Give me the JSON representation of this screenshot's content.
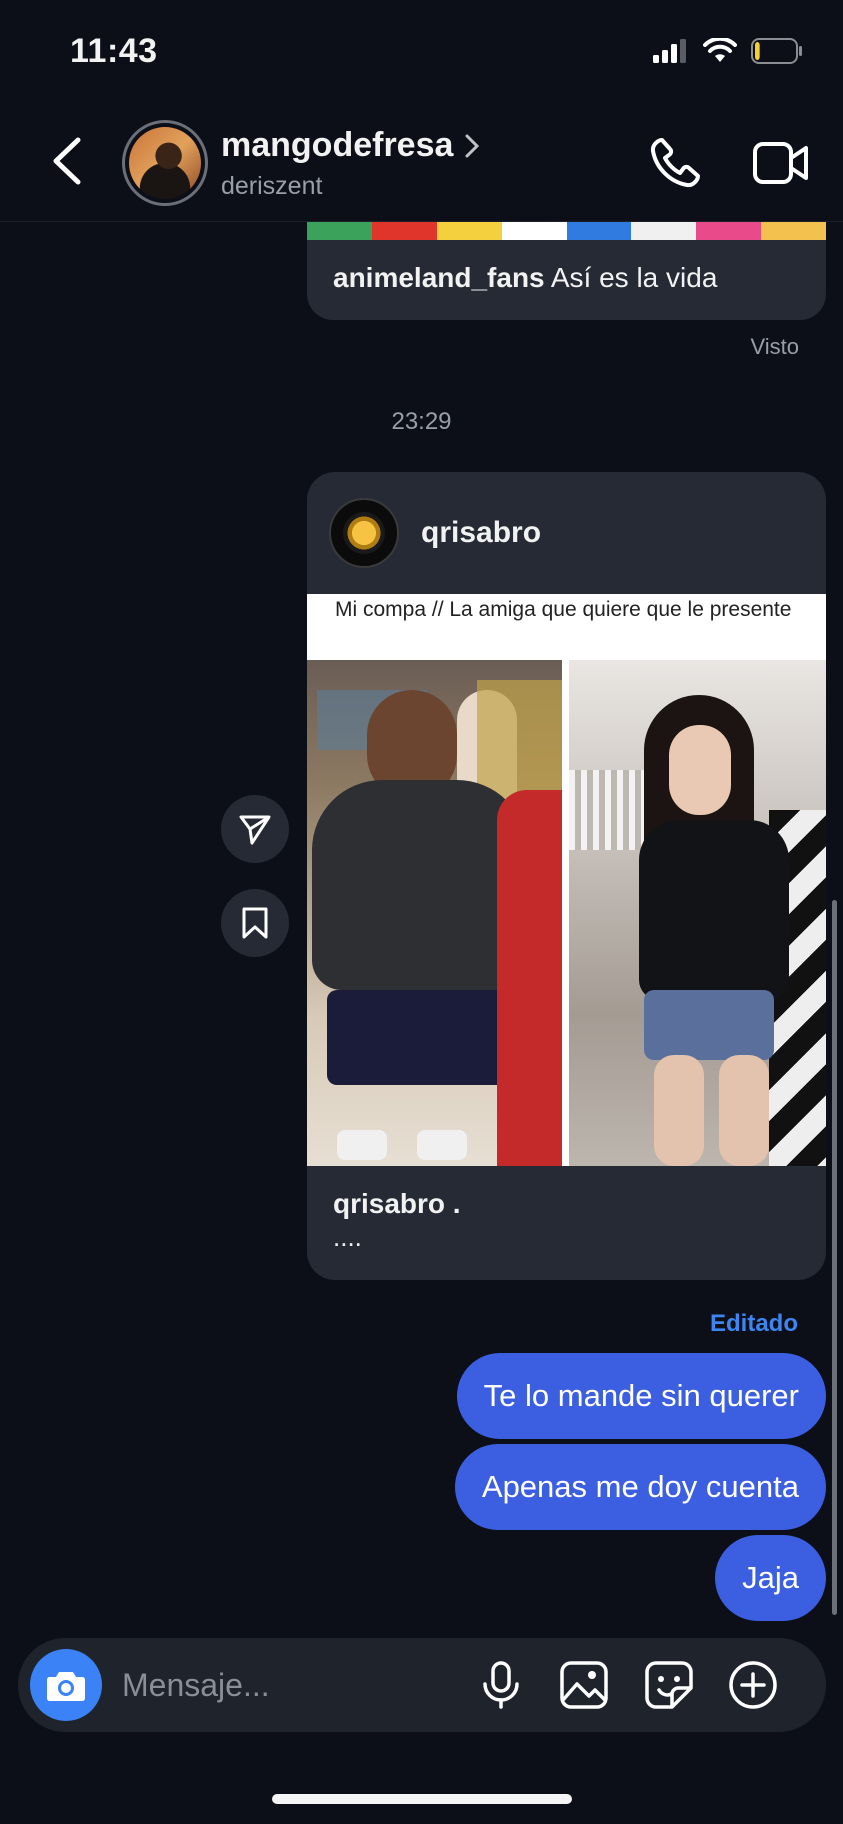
{
  "status_bar": {
    "time": "11:43",
    "battery_level": 0.12
  },
  "header": {
    "contact_name": "mangodefresa",
    "contact_username": "deriszent"
  },
  "previous_post": {
    "user": "animeland_fans",
    "caption": "Así es la vida"
  },
  "seen_label": "Visto",
  "time_divider": "23:29",
  "shared_post": {
    "user": "qrisabro",
    "meme_text": "Mi compa // La amiga que quiere que le presente",
    "footer_user": "qrisabro .",
    "footer_caption": "...."
  },
  "edited_label": "Editado",
  "messages": [
    {
      "text": "Te lo mande sin querer"
    },
    {
      "text": "Apenas me doy cuenta"
    },
    {
      "text": "Jaja"
    }
  ],
  "composer": {
    "placeholder": "Mensaje..."
  },
  "colors": {
    "accent": "#3b5fe0",
    "link_blue": "#3d86f2",
    "background": "#0c0f17",
    "card": "#262a34"
  }
}
